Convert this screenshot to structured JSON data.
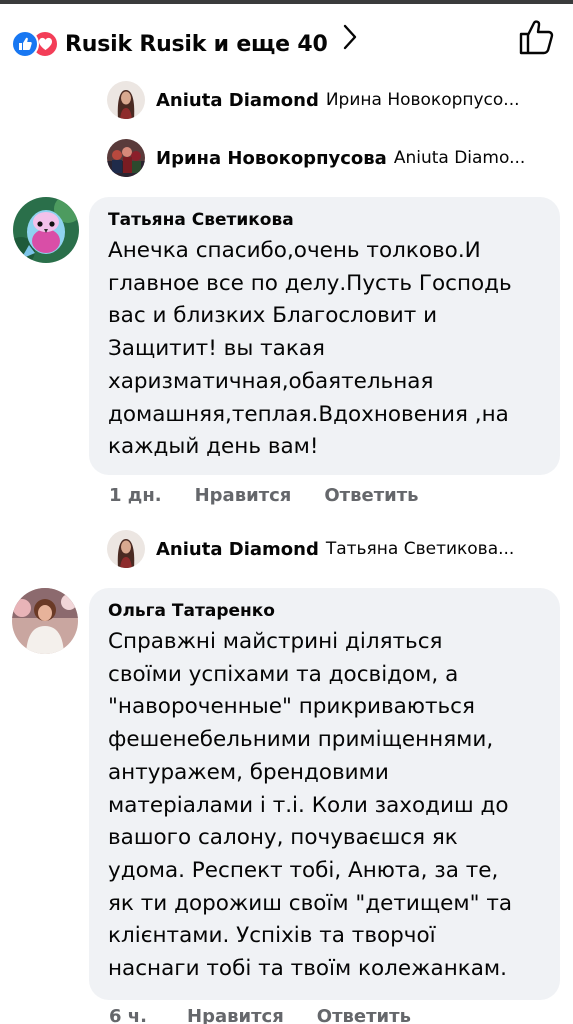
{
  "colors": {
    "accent": "#1877f2",
    "love": "#f33e58",
    "bubble": "#f0f2f5",
    "meta": "#65676b"
  },
  "reactions": {
    "icons": [
      "like-icon",
      "love-icon"
    ],
    "summary": "Rusik Rusik и еще 40"
  },
  "replies_top": [
    {
      "name": "Aniuta Diamond",
      "preview": "Ирина Новокорпусо..."
    },
    {
      "name": "Ирина Новокорпусова",
      "preview": "Aniuta Diamo..."
    }
  ],
  "comments": [
    {
      "author": "Татьяна Светикова",
      "text": "Анечка спасибо,очень толково.И\nглавное все по делу.Пусть Господь\nвас и близких Благословит и\nЗащитит! вы такая\nхаризматичная,обаятельная\nдомашняя,теплая.Вдохновения ,на\nкаждый день вам!",
      "time": "1 дн.",
      "like_label": "Нравится",
      "reply_label": "Ответить",
      "reply_preview": {
        "name": "Aniuta Diamond",
        "preview": "Татьяна Светикова..."
      }
    },
    {
      "author": "Ольга Татаренко",
      "text": "Справжні майстрині діляться\nсвоїми успіхами та досвідом, а\n\"навороченные\" прикриваються\nфешенебельними приміщеннями,\nантуражем, брендовими\nматеріалами і т.і. Коли заходиш до\nвашого салону, почуваєшся як\nудома. Респект тобі, Анюта, за те,\nяк ти дорожиш своїм \"детищем\" та\nклієнтами. Успіхів та творчої\nнаснаги тобі та твоїм колежанкам.",
      "time": "6 ч.",
      "like_label": "Нравится",
      "reply_label": "Ответить"
    }
  ]
}
